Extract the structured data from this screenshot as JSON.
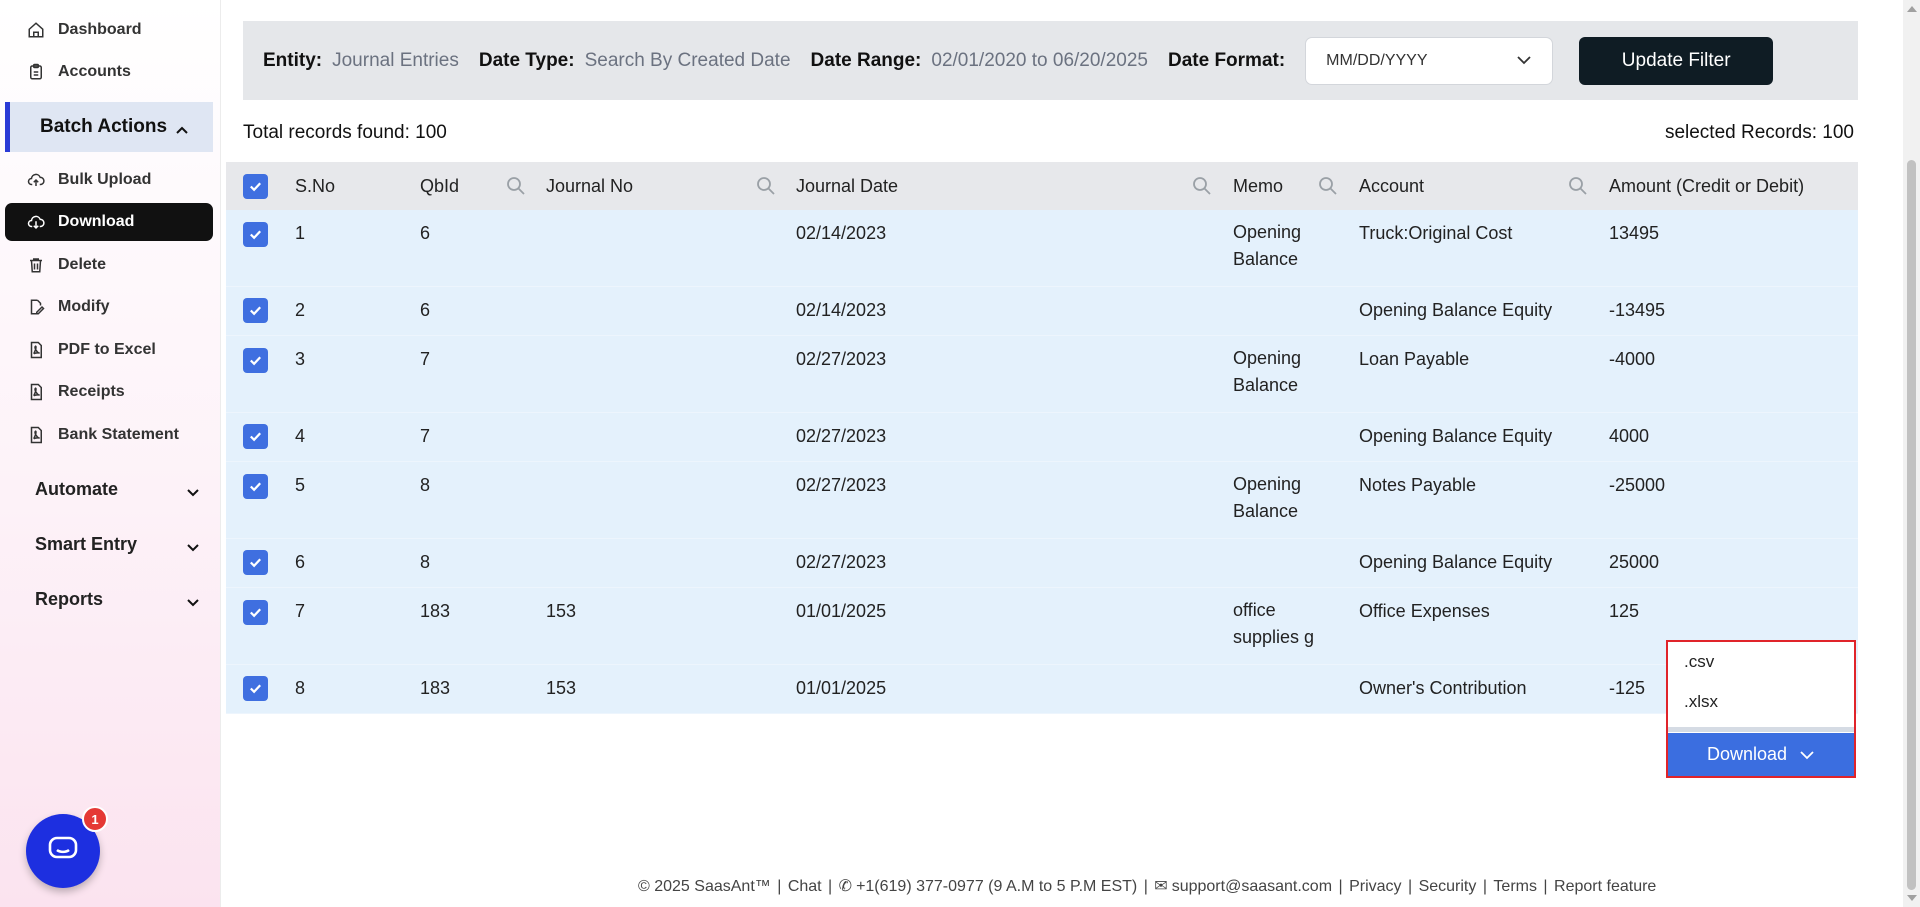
{
  "sidebar": {
    "items_top": [
      {
        "label": "Dashboard",
        "icon": "home-icon"
      },
      {
        "label": "Accounts",
        "icon": "clipboard-icon"
      }
    ],
    "group": {
      "label": "Batch Actions"
    },
    "batch_items": [
      {
        "label": "Bulk Upload",
        "icon": "cloud-upload-icon"
      },
      {
        "label": "Download",
        "icon": "cloud-download-icon"
      },
      {
        "label": "Delete",
        "icon": "trash-icon"
      },
      {
        "label": "Modify",
        "icon": "edit-file-icon"
      },
      {
        "label": "PDF to Excel",
        "icon": "pdf-icon"
      },
      {
        "label": "Receipts",
        "icon": "pdf-icon"
      },
      {
        "label": "Bank Statement",
        "icon": "pdf-icon"
      }
    ],
    "sections": [
      {
        "label": "Automate"
      },
      {
        "label": "Smart Entry"
      },
      {
        "label": "Reports"
      }
    ]
  },
  "filter": {
    "entity_label": "Entity:",
    "entity_value": "Journal Entries",
    "date_type_label": "Date Type:",
    "date_type_value": "Search By Created Date",
    "date_range_label": "Date Range:",
    "date_range_value": "02/01/2020 to 06/20/2025",
    "date_format_label": "Date Format:",
    "date_format_value": "MM/DD/YYYY",
    "update_button": "Update Filter"
  },
  "summary": {
    "total": "Total records found: 100",
    "selected": "selected Records: 100"
  },
  "table": {
    "headers": [
      "S.No",
      "QbId",
      "Journal No",
      "Journal Date",
      "Memo",
      "Account",
      "Amount (Credit or Debit)"
    ],
    "rows": [
      {
        "sno": "1",
        "qbid": "6",
        "journal_no": "",
        "date": "02/14/2023",
        "memo": "Opening Balance",
        "account": "Truck:Original Cost",
        "amount": "13495"
      },
      {
        "sno": "2",
        "qbid": "6",
        "journal_no": "",
        "date": "02/14/2023",
        "memo": "",
        "account": "Opening Balance Equity",
        "amount": "-13495"
      },
      {
        "sno": "3",
        "qbid": "7",
        "journal_no": "",
        "date": "02/27/2023",
        "memo": "Opening Balance",
        "account": "Loan Payable",
        "amount": "-4000"
      },
      {
        "sno": "4",
        "qbid": "7",
        "journal_no": "",
        "date": "02/27/2023",
        "memo": "",
        "account": "Opening Balance Equity",
        "amount": "4000"
      },
      {
        "sno": "5",
        "qbid": "8",
        "journal_no": "",
        "date": "02/27/2023",
        "memo": "Opening Balance",
        "account": "Notes Payable",
        "amount": "-25000"
      },
      {
        "sno": "6",
        "qbid": "8",
        "journal_no": "",
        "date": "02/27/2023",
        "memo": "",
        "account": "Opening Balance Equity",
        "amount": "25000"
      },
      {
        "sno": "7",
        "qbid": "183",
        "journal_no": "153",
        "date": "01/01/2025",
        "memo": "office supplies g",
        "account": "Office Expenses",
        "amount": "125"
      },
      {
        "sno": "8",
        "qbid": "183",
        "journal_no": "153",
        "date": "01/01/2025",
        "memo": "",
        "account": "Owner's Contribution",
        "amount": "-125"
      }
    ]
  },
  "download_menu": {
    "options": [
      ".csv",
      ".xlsx"
    ],
    "button": "Download"
  },
  "chat": {
    "badge": "1"
  },
  "footer": {
    "copyright": "© 2025 SaasAnt™",
    "chat": "Chat",
    "phone": "+1(619) 377-0977 (9 A.M to 5 P.M EST)",
    "email": "support@saasant.com",
    "privacy": "Privacy",
    "security": "Security",
    "terms": "Terms",
    "report": "Report feature"
  },
  "colors": {
    "accent": "#3b6ee0",
    "row_bg": "#e4f1fc",
    "active_nav": "#111111",
    "highlight_border": "#e0242a"
  }
}
